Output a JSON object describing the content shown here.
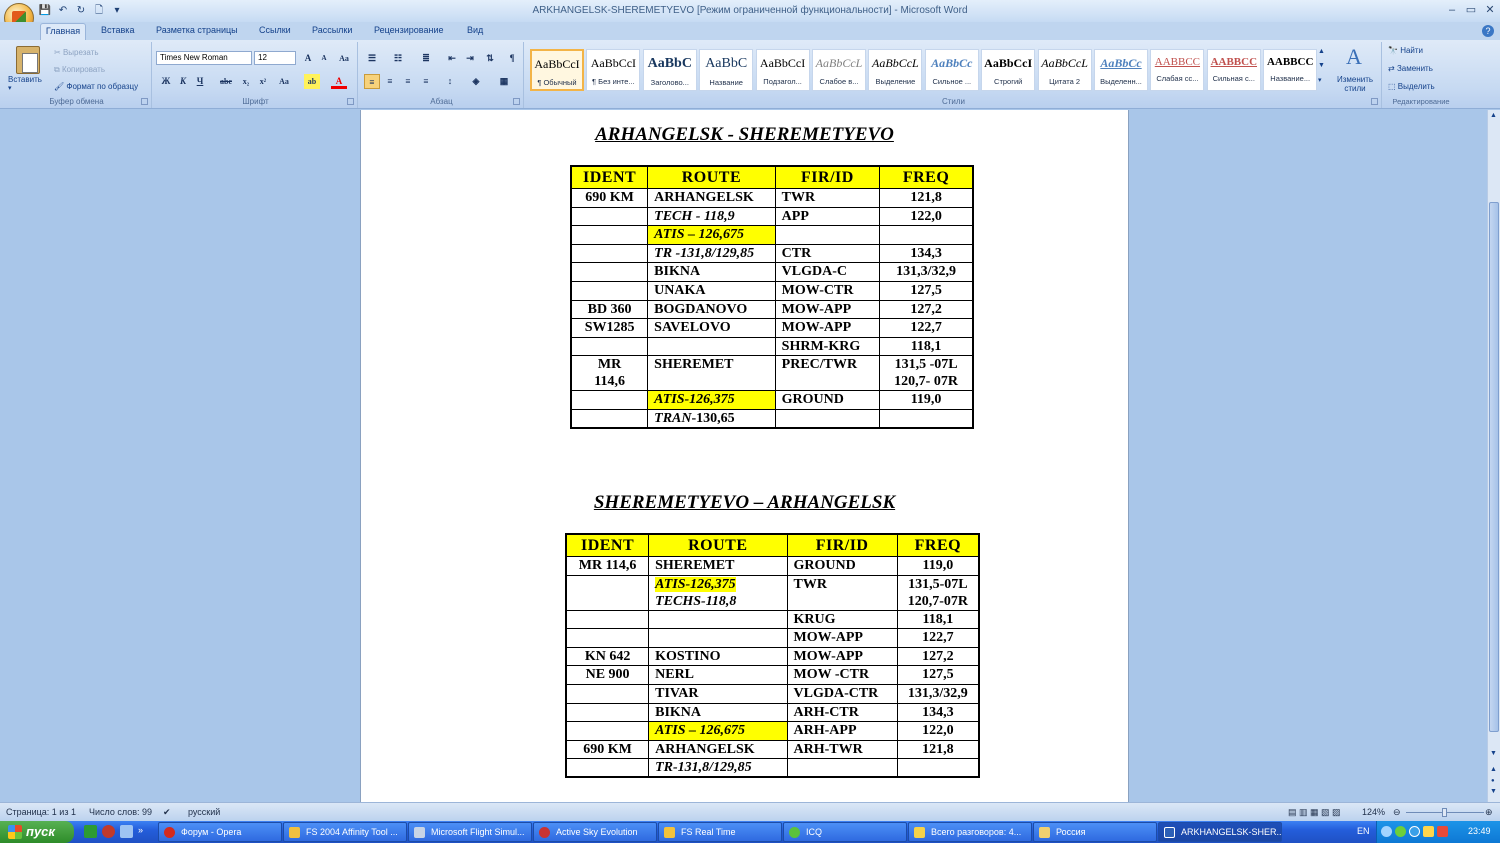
{
  "window": {
    "title": "ARKHANGELSK-SHEREMETYEVO [Режим ограниченной функциональности] - Microsoft Word",
    "minimize": "–",
    "maximize": "▭",
    "close": "✕"
  },
  "qat": {
    "save": "💾",
    "undo": "↶",
    "redo": "↻",
    "new": "🗋",
    "more": "▾"
  },
  "tabs": [
    "Главная",
    "Вставка",
    "Разметка страницы",
    "Ссылки",
    "Рассылки",
    "Рецензирование",
    "Вид"
  ],
  "ribbon": {
    "clipboard": {
      "label": "Буфер обмена",
      "paste": "Вставить",
      "cut": "Вырезать",
      "copy": "Копировать",
      "format_painter": "Формат по образцу"
    },
    "font": {
      "label": "Шрифт",
      "name": "Times New Roman",
      "size": "12",
      "grow": "A",
      "shrink": "A",
      "clear": "Aa",
      "bold": "Ж",
      "italic": "К",
      "underline": "Ч",
      "strike": "abe",
      "sub": "x₂",
      "sup": "x²",
      "case": "Aa",
      "highlight": "ab",
      "color": "A"
    },
    "paragraph": {
      "label": "Абзац"
    },
    "styles": {
      "label": "Стили",
      "change": "Изменить стили",
      "items": [
        {
          "sample": "AaBbCcI",
          "name": "¶ Обычный"
        },
        {
          "sample": "AaBbCcI",
          "name": "¶ Без инте..."
        },
        {
          "sample": "AaBbC",
          "name": "Заголово..."
        },
        {
          "sample": "AaBbC",
          "name": "Название"
        },
        {
          "sample": "AaBbCcI",
          "name": "Подзагол..."
        },
        {
          "sample": "AaBbCcL",
          "name": "Слабое в..."
        },
        {
          "sample": "AaBbCcL",
          "name": "Выделение"
        },
        {
          "sample": "AaBbCc",
          "name": "Сильное ..."
        },
        {
          "sample": "AaBbCcI",
          "name": "Строгий"
        },
        {
          "sample": "AaBbCcL",
          "name": "Цитата 2"
        },
        {
          "sample": "AaBbCc",
          "name": "Выделенн..."
        },
        {
          "sample": "AABBCC",
          "name": "Слабая сс..."
        },
        {
          "sample": "AABBCC",
          "name": "Сильная с..."
        },
        {
          "sample": "AABBCC",
          "name": "Название..."
        }
      ]
    },
    "editing": {
      "label": "Редактирование",
      "find": "Найти",
      "replace": "Заменить",
      "select": "Выделить"
    }
  },
  "document": {
    "route1": {
      "title": "ARHANGELSK - SHEREMETYEVO",
      "headers": [
        "IDENT",
        "ROUTE",
        "FIR/ID",
        "FREQ"
      ],
      "rows": [
        {
          "ident": "690 KM",
          "route": "ARHANGELSK",
          "fir": "TWR",
          "freq": "121,8"
        },
        {
          "ident": "",
          "route": "TECH - 118,9",
          "fir": "APP",
          "freq": "122,0"
        },
        {
          "ident": "",
          "route": "ATIS – 126,675",
          "fir": "",
          "freq": ""
        },
        {
          "ident": "",
          "route": "TR -131,8/129,85",
          "fir": "CTR",
          "freq": "134,3"
        },
        {
          "ident": "",
          "route": "BIKNA",
          "fir": "VLGDA-C",
          "freq": "131,3/32,9"
        },
        {
          "ident": "",
          "route": "UNAKA",
          "fir": "MOW-CTR",
          "freq": "127,5"
        },
        {
          "ident": "BD 360",
          "route": "BOGDANOVO",
          "fir": "MOW-APP",
          "freq": "127,2"
        },
        {
          "ident": "SW1285",
          "route": "SAVELOVO",
          "fir": "MOW-APP",
          "freq": "122,7"
        },
        {
          "ident": "",
          "route": "",
          "fir": "SHRM-KRG",
          "freq": "118,1"
        },
        {
          "ident": "MR",
          "ident2": "114,6",
          "route": "SHEREMET",
          "fir": "PREC/TWR",
          "freq": "131,5 -07L",
          "freq2": "120,7- 07R"
        },
        {
          "ident": "",
          "route": "ATIS-126,375",
          "fir": "GROUND",
          "freq": "119,0"
        },
        {
          "ident": "",
          "route_it": "TRAN",
          "route": "-130,65",
          "fir": "",
          "freq": ""
        }
      ]
    },
    "route2": {
      "title": "SHEREMETYEVO – ARHANGELSK",
      "headers": [
        "IDENT",
        "ROUTE",
        "FIR/ID",
        "FREQ"
      ],
      "rows": [
        {
          "ident": "MR 114,6",
          "route": "SHEREMET",
          "fir": "GROUND",
          "freq": "119,0"
        },
        {
          "ident": "",
          "route": "ATIS-126,375",
          "route2": "TECHS-118,8",
          "fir": "TWR",
          "freq": "131,5-07L",
          "freq2": "120,7-07R"
        },
        {
          "ident": "",
          "route": "",
          "fir": "KRUG",
          "freq": "118,1"
        },
        {
          "ident": "",
          "route": "",
          "fir": "MOW-APP",
          "freq": "122,7"
        },
        {
          "ident": "KN 642",
          "route": "KOSTINO",
          "fir": "MOW-APP",
          "freq": "127,2"
        },
        {
          "ident": "NE 900",
          "route": "NERL",
          "fir": "MOW -CTR",
          "freq": "127,5"
        },
        {
          "ident": "",
          "route": "TIVAR",
          "fir": "VLGDA-CTR",
          "freq": "131,3/32,9"
        },
        {
          "ident": "",
          "route": "BIKNA",
          "fir": "ARH-CTR",
          "freq": "134,3"
        },
        {
          "ident": "",
          "route": "ATIS – 126,675",
          "fir": "ARH-APP",
          "freq": "122,0"
        },
        {
          "ident": "690 KM",
          "route": "ARHANGELSK",
          "fir": "ARH-TWR",
          "freq": "121,8"
        },
        {
          "ident": "",
          "route": "TR-131,8/129,85",
          "fir": "",
          "freq": ""
        }
      ]
    }
  },
  "status": {
    "page": "Страница: 1 из 1",
    "words": "Число слов: 99",
    "lang": "русский",
    "zoom": "124%"
  },
  "taskbar": {
    "start": "пуск",
    "items": [
      "Форум - Opera",
      "FS 2004 Affinity Tool ...",
      "Microsoft Flight Simul...",
      "Active Sky Evolution",
      "FS Real Time",
      "ICQ",
      "Всего разговоров: 4...",
      "Россия",
      "ARKHANGELSK-SHER..."
    ],
    "lang": "EN",
    "clock": "23:49"
  },
  "colors": {
    "highlight": "#ffff00",
    "taskbar": "#245edb",
    "ribbon": "#dfeaf8"
  }
}
